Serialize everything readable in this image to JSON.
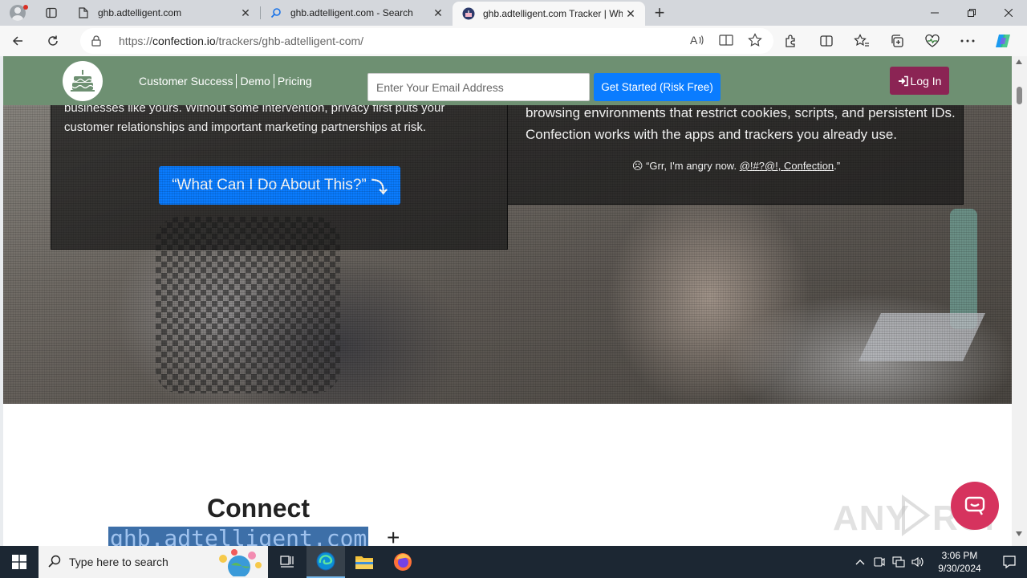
{
  "browser": {
    "tabs": [
      {
        "title": "ghb.adtelligent.com",
        "icon": "page-icon",
        "active": false
      },
      {
        "title": "ghb.adtelligent.com - Search",
        "icon": "search-icon",
        "active": false
      },
      {
        "title": "ghb.adtelligent.com Tracker | Wh",
        "icon": "confection-favicon",
        "active": true
      }
    ],
    "address": {
      "scheme": "https://",
      "host": "confection.io",
      "path": "/trackers/ghb-adtelligent-com/"
    }
  },
  "site": {
    "nav": {
      "links": [
        "Customer Success",
        "Demo",
        "Pricing"
      ],
      "email_placeholder": "Enter Your Email Address",
      "get_started": "Get Started (Risk Free)",
      "login": "Log In"
    },
    "left_panel": {
      "text": "businesses like yours. Without some intervention, privacy first puts your customer relationships and important marketing partnerships at risk.",
      "cta": "“What Can I Do About This?”"
    },
    "right_panel": {
      "text": "browsing environments that restrict cookies, scripts, and persistent IDs. Confection works with the apps and trackers you already use.",
      "quote_prefix": "“Grr, I'm angry now. ",
      "quote_link": "@!#?@!, Confection",
      "quote_suffix": ".”"
    },
    "connect": {
      "title": "Connect",
      "code": "ghb.adtelligent.com",
      "plus": "+"
    },
    "watermark": "ANY RUN"
  },
  "taskbar": {
    "search_placeholder": "Type here to search",
    "time": "3:06 PM",
    "date": "9/30/2024"
  },
  "colors": {
    "nav_green": "#6e9072",
    "primary_blue": "#0a7cff",
    "login_maroon": "#8b2454",
    "chat_pink": "#d6335e"
  }
}
